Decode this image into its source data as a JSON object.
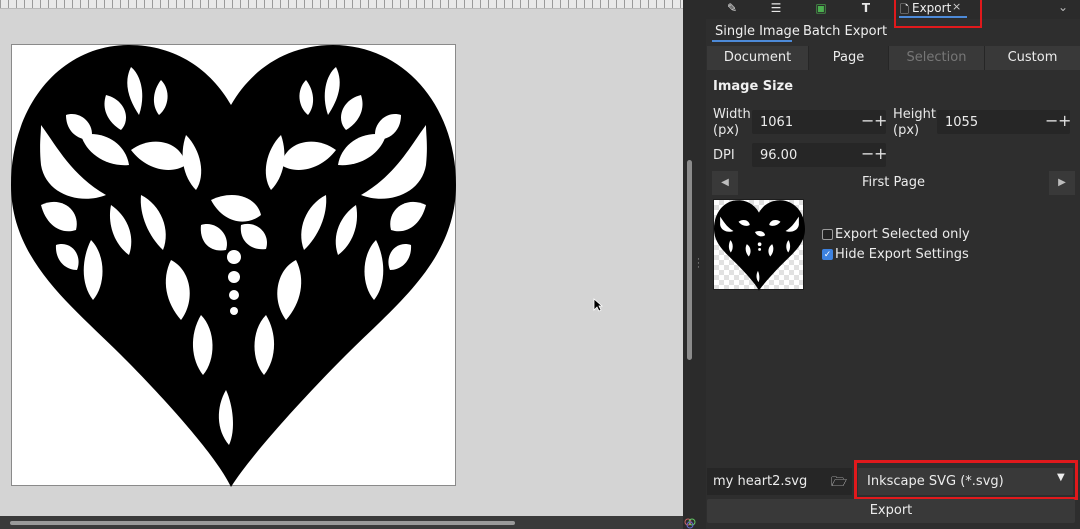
{
  "dock": {
    "tab_icons": [
      "pencil-icon",
      "align-icon",
      "image-icon",
      "text-icon"
    ],
    "active_tab": {
      "label": "Export",
      "close": "×"
    },
    "overflow": "⌄"
  },
  "export": {
    "sub_tabs": {
      "single": "Single Image",
      "batch": "Batch Export"
    },
    "modes": [
      "Document",
      "Page",
      "Selection",
      "Custom"
    ],
    "active_mode": "Page",
    "disabled_mode": "Selection",
    "image_size_heading": "Image Size",
    "width_label": "Width\n(px)",
    "width_value": "1061",
    "height_label": "Height\n(px)",
    "height_value": "1055",
    "dpi_label": "DPI",
    "dpi_value": "96.00",
    "spin_minus": "−",
    "spin_plus": "+",
    "page_name": "First Page",
    "prev_glyph": "◀",
    "next_glyph": "▶",
    "export_selected_only": "Export Selected only",
    "export_selected_only_checked": false,
    "hide_export_settings": "Hide Export Settings",
    "hide_export_settings_checked": true,
    "filename": "my heart2.svg",
    "format": "Inkscape SVG (*.svg)",
    "export_button": "Export"
  },
  "colors": {
    "accent": "#4d8ad8",
    "highlight_annotation": "#e0191c",
    "panel_bg": "#2e2e2e",
    "canvas_bg": "#d4d4d4"
  }
}
